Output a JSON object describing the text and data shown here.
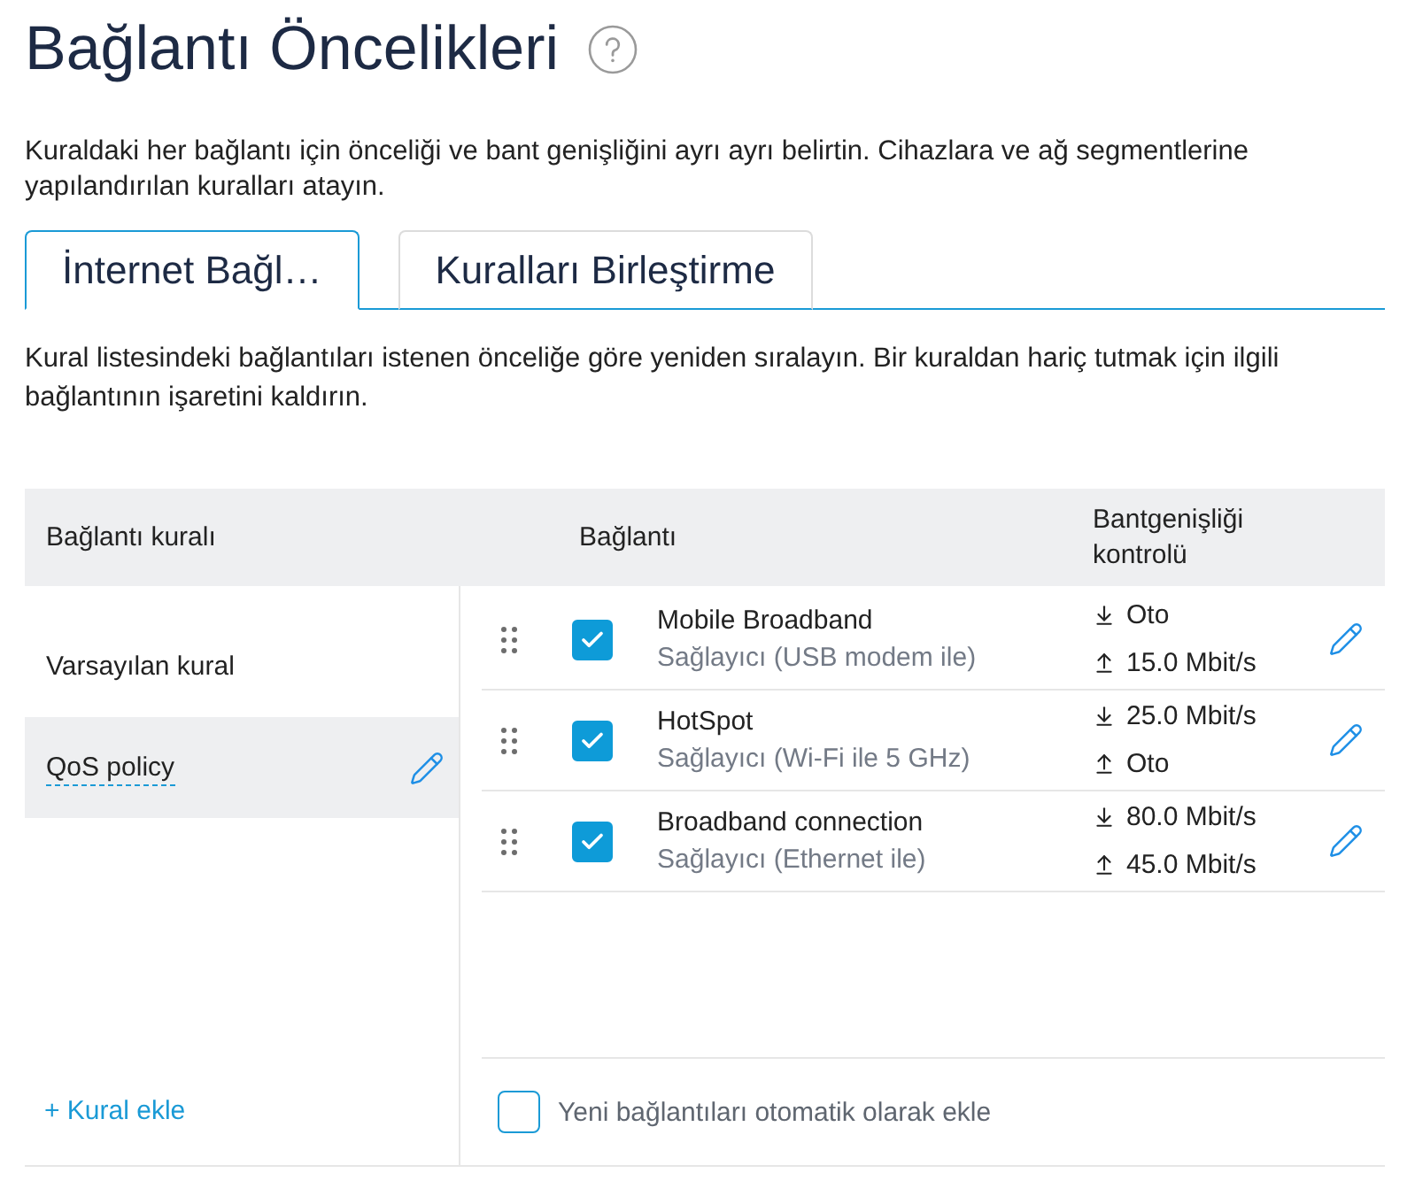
{
  "page": {
    "title": "Bağlantı Öncelikleri",
    "description": "Kuraldaki her bağlantı için önceliği ve bant genişliğini ayrı ayrı belirtin. Cihazlara ve ağ segmentlerine yapılandırılan kuralları atayın."
  },
  "tabs": [
    {
      "label": "İnternet Bağl…",
      "selected": true
    },
    {
      "label": "Kuralları Birleştirme",
      "selected": false
    }
  ],
  "tab_description": "Kural listesindeki bağlantıları istenen önceliğe göre yeniden sıralayın. Bir kuraldan hariç tutmak için ilgili bağlantının işaretini kaldırın.",
  "table": {
    "columns": [
      "Bağlantı kuralı",
      "Bağlantı",
      "Bantgenişliği kontrolü"
    ],
    "rules": [
      {
        "name": "Varsayılan kural",
        "selected": false
      },
      {
        "name": "QoS policy",
        "selected": true
      }
    ],
    "add_rule": "+ Kural ekle",
    "connections": [
      {
        "name": "Mobile Broadband",
        "provider": "Sağlayıcı (USB modem ile)",
        "checked": true,
        "download": "Oto",
        "upload": "15.0 Mbit/s"
      },
      {
        "name": "HotSpot",
        "provider": "Sağlayıcı (Wi-Fi ile 5 GHz)",
        "checked": true,
        "download": "25.0 Mbit/s",
        "upload": "Oto"
      },
      {
        "name": "Broadband connection",
        "provider": "Sağlayıcı (Ethernet ile)",
        "checked": true,
        "download": "80.0 Mbit/s",
        "upload": "45.0 Mbit/s"
      }
    ],
    "auto_add": {
      "label": "Yeni bağlantıları otomatik olarak ekle",
      "checked": false
    }
  }
}
